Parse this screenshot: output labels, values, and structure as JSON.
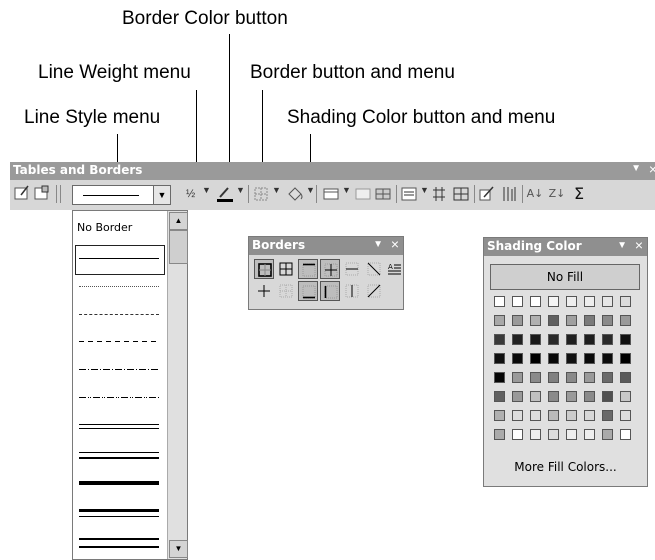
{
  "callouts": {
    "border_color": "Border Color button",
    "line_weight": "Line Weight menu",
    "border_button": "Border button and menu",
    "line_style": "Line Style menu",
    "shading_color": "Shading Color button and menu"
  },
  "toolbar": {
    "title": "Tables and Borders",
    "line_weight_value": "½",
    "title_arrow": "▼",
    "title_close": "×",
    "icons": [
      "draw-table-icon",
      "eraser-icon",
      "border-color-icon",
      "border-icon",
      "shading-color-icon",
      "insert-table-icon",
      "merge-cells-icon",
      "split-cells-icon",
      "align-icon",
      "distribute-rows-icon",
      "distribute-columns-icon",
      "autoformat-icon",
      "text-direction-icon",
      "sort-ascending-icon",
      "sort-descending-icon",
      "autosum-icon"
    ]
  },
  "line_style_menu": {
    "no_border_label": "No Border",
    "styles": [
      "single",
      "dotted",
      "dashed-fine",
      "dashed",
      "dash-dot",
      "dash-dot-dot",
      "double",
      "thin-thick",
      "thick",
      "thick-thin",
      "triple"
    ]
  },
  "borders_palette": {
    "title": "Borders",
    "arrow": "▼",
    "close": "×",
    "buttons": [
      "outside-border",
      "all-borders",
      "top-border",
      "inside-borders",
      "inside-horizontal-border",
      "diagonal-down-border",
      "horizontal-line",
      "inside-vertical-border",
      "no-border",
      "bottom-border",
      "left-border",
      "right-border",
      "diagonal-up-border"
    ]
  },
  "shading_palette": {
    "title": "Shading Color",
    "arrow": "▼",
    "close": "×",
    "no_fill_label": "No Fill",
    "more_fill_label": "More Fill Colors...",
    "swatch_rows": [
      [
        "#ffffff",
        "#ffffff",
        "#ffffff",
        "#f4f4f4",
        "#eeeeee",
        "#eeeeee",
        "#e6e6e6",
        "#dcdcdc"
      ],
      [
        "#a8a8a8",
        "#9a9a9a",
        "#b0b0b0",
        "#606060",
        "#a0a0a0",
        "#7a7a7a",
        "#8a8a8a",
        "#9a9a9a"
      ],
      [
        "#3a3a3a",
        "#222222",
        "#1a1a1a",
        "#2a2a2a",
        "#202020",
        "#1e1e1e",
        "#2a2a2a",
        "#111111"
      ],
      [
        "#101010",
        "#0a0a0a",
        "#000000",
        "#080808",
        "#111111",
        "#0a0a0a",
        "#0c0c0c",
        "#000000"
      ],
      [
        "#050505",
        "#9a9a9a",
        "#8a8a8a",
        "#808080",
        "#8a8a8a",
        "#9a9a9a",
        "#6a6a6a",
        "#5a5a5a"
      ],
      [
        "#606060",
        "#9a9a9a",
        "#c0c0c0",
        "#8a8a8a",
        "#9a9a9a",
        "#8a8a8a",
        "#505050",
        "#c8c8c8"
      ],
      [
        "#b0b0b0",
        "#dddddd",
        "#dddddd",
        "#bbbbbb",
        "#cccccc",
        "#d8d8d8",
        "#6a6a6a",
        "#dddddd"
      ],
      [
        "#aaaaaa",
        "#ffffff",
        "#eeeeee",
        "#dddddd",
        "#eeeeee",
        "#eeeeee",
        "#aaaaaa",
        "#ffffff"
      ]
    ]
  }
}
